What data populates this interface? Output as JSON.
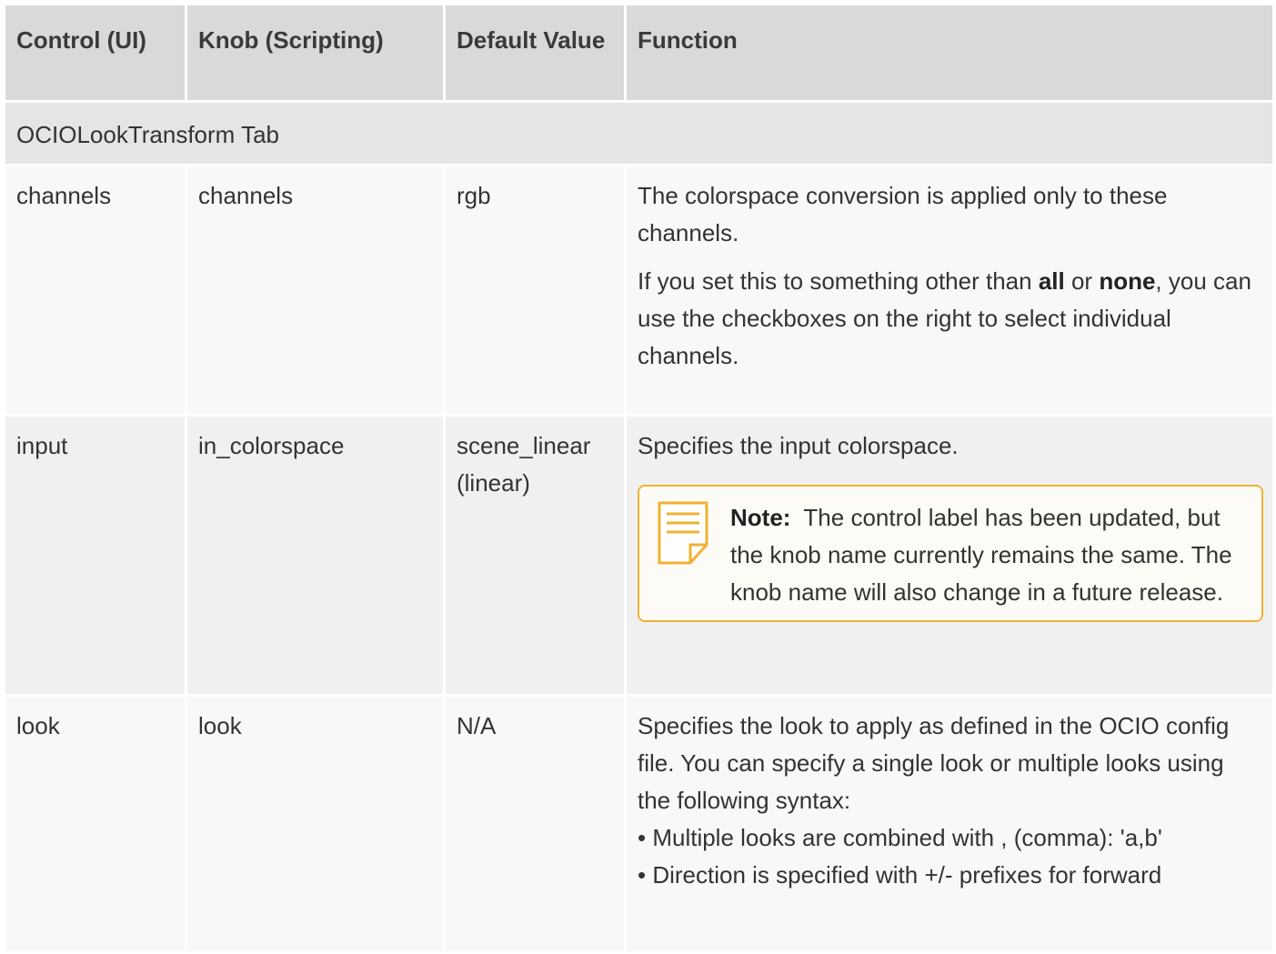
{
  "headers": {
    "control": "Control (UI)",
    "knob": "Knob (Scripting)",
    "default": "Default Value",
    "function": "Function"
  },
  "section": "OCIOLookTransform Tab",
  "rows": [
    {
      "control": "channels",
      "knob": "channels",
      "default": "rgb",
      "p1": "The colorspace conversion is applied only to these channels.",
      "p2_a": "If you set this to something other than ",
      "p2_b": "all",
      "p2_c": " or ",
      "p2_d": "none",
      "p2_e": ", you can use the checkboxes on the right to select individual channels."
    },
    {
      "control": "input",
      "knob": "in_colorspace",
      "default_line1": "scene_linear",
      "default_line2": "(linear)",
      "p1": "Specifies the input colorspace.",
      "note_label": "Note:",
      "note_text": "The control label has been updated, but the knob name currently remains the same. The knob name will also change in a future release."
    },
    {
      "control": "look",
      "knob": "look",
      "default": "N/A",
      "p1": "Specifies the look to apply as defined in the OCIO config file. You can specify a single look or multiple looks using the following syntax:",
      "bullet1": "• Multiple looks are combined with , (comma): 'a,b'",
      "bullet2": "• Direction is specified with +/- prefixes for forward"
    }
  ],
  "colors": {
    "header_bg": "#d9d9d9",
    "note_border": "#f0b233"
  },
  "icons": {
    "note": "note-page-icon"
  }
}
